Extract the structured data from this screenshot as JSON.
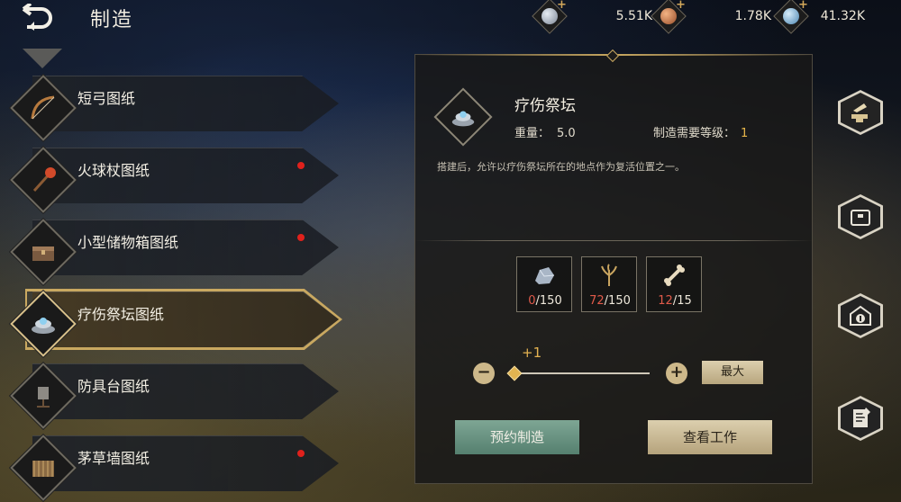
{
  "header": {
    "title": "制造",
    "currencies": [
      {
        "name": "silver-coin-icon",
        "amount": "5.51K",
        "color": "#a9b3c2"
      },
      {
        "name": "bronze-coin-icon",
        "amount": "1.78K",
        "color": "#c98155"
      },
      {
        "name": "blue-gem-icon",
        "amount": "41.32K",
        "color": "#7fb3d6"
      }
    ],
    "plus_sign": "+"
  },
  "blueprints": [
    {
      "label": "短弓图纸",
      "icon": "bow-icon",
      "new": false,
      "selected": false
    },
    {
      "label": "火球杖图纸",
      "icon": "fireball-staff-icon",
      "new": true,
      "selected": false
    },
    {
      "label": "小型储物箱图纸",
      "icon": "storage-chest-icon",
      "new": true,
      "selected": false
    },
    {
      "label": "疗伤祭坛图纸",
      "icon": "healing-altar-icon",
      "new": false,
      "selected": true
    },
    {
      "label": "防具台图纸",
      "icon": "armor-stand-icon",
      "new": false,
      "selected": false
    },
    {
      "label": "茅草墙图纸",
      "icon": "thatch-wall-icon",
      "new": true,
      "selected": false
    }
  ],
  "detail": {
    "name": "疗伤祭坛",
    "weight_label": "重量：",
    "weight": "5.0",
    "level_label": "制造需要等级：",
    "level": "1",
    "description": "搭建后，允许以疗伤祭坛所在的地点作为复活位置之一。",
    "materials": [
      {
        "icon": "stone-icon",
        "have": "0",
        "need": "/150"
      },
      {
        "icon": "fiber-icon",
        "have": "72",
        "need": "/150"
      },
      {
        "icon": "bone-icon",
        "have": "12",
        "need": "/15"
      }
    ],
    "quantity_delta": "+1",
    "minus": "−",
    "plus": "+",
    "max_label": "最大",
    "reserve_label": "预约制造",
    "view_label": "查看工作"
  },
  "rail": [
    {
      "name": "anvil-hammer-icon"
    },
    {
      "name": "storage-box-icon"
    },
    {
      "name": "shop-coin-icon"
    },
    {
      "name": "document-list-icon"
    }
  ]
}
